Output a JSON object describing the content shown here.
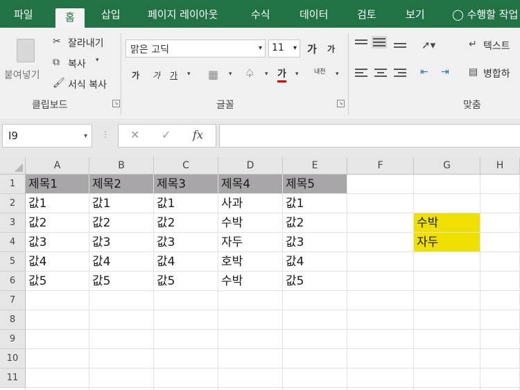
{
  "ribbon_tabs": [
    "파일",
    "홈",
    "삽입",
    "페이지 레이아웃",
    "수식",
    "데이터",
    "검토",
    "보기"
  ],
  "tell_me": "수행할 작업",
  "clipboard": {
    "paste_label": "붙여넣기",
    "cut_label": "잘라내기",
    "copy_label": "복사",
    "format_painter_label": "서식 복사",
    "group_label": "클립보드"
  },
  "font": {
    "font_name": "맑은 고딕",
    "font_size": "11",
    "grow_label": "가",
    "shrink_label": "가",
    "bold_label": "가",
    "italic_label": "가",
    "underline_label": "가",
    "font_color_label": "가",
    "phonetic_label": "내천",
    "group_label": "글꼴",
    "font_color": "#e00000"
  },
  "alignment": {
    "wrap_text_label": "텍스트",
    "merge_label": "병합하",
    "group_label": "맞춤"
  },
  "formula_bar": {
    "name_box": "I9",
    "fx_label": "fx",
    "formula_value": ""
  },
  "sheet": {
    "columns": [
      "A",
      "B",
      "C",
      "D",
      "E",
      "F",
      "G",
      "H"
    ],
    "rows": [
      "1",
      "2",
      "3",
      "4",
      "5",
      "6",
      "7",
      "8",
      "9",
      "10",
      "11"
    ],
    "header_row": [
      "제목1",
      "제목2",
      "제목3",
      "제목4",
      "제목5"
    ],
    "data_rows": [
      [
        "값1",
        "값1",
        "값1",
        "사과",
        "값1"
      ],
      [
        "값2",
        "값2",
        "값2",
        "수박",
        "값2"
      ],
      [
        "값3",
        "값3",
        "값3",
        "자두",
        "값3"
      ],
      [
        "값4",
        "값4",
        "값4",
        "호박",
        "값4"
      ],
      [
        "값5",
        "값5",
        "값5",
        "수박",
        "값5"
      ]
    ],
    "highlight_cells": [
      "수박",
      "자두"
    ],
    "header_fill": "#a8a6a8",
    "highlight_fill": "#f0e000"
  },
  "theme": {
    "accent": "#217346"
  }
}
